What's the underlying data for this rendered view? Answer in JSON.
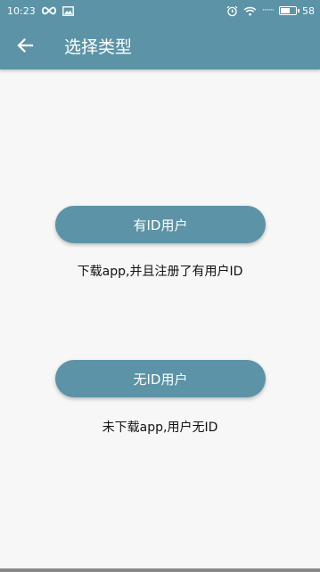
{
  "status_bar": {
    "time": "10:23",
    "battery": "58",
    "signal_text": "·······",
    "icons": [
      "infinity-icon",
      "image-icon",
      "alarm-icon",
      "wifi-icon",
      "signal-icon",
      "battery-icon"
    ]
  },
  "toolbar": {
    "title": "选择类型",
    "back_icon": "arrow-left-icon"
  },
  "options": [
    {
      "label": "有ID用户",
      "description": "下载app,并且注册了有用户ID"
    },
    {
      "label": "无ID用户",
      "description": "未下载app,用户无ID"
    }
  ],
  "colors": {
    "primary": "#5c93a6",
    "background": "#f7f7f7",
    "text": "#111111"
  }
}
